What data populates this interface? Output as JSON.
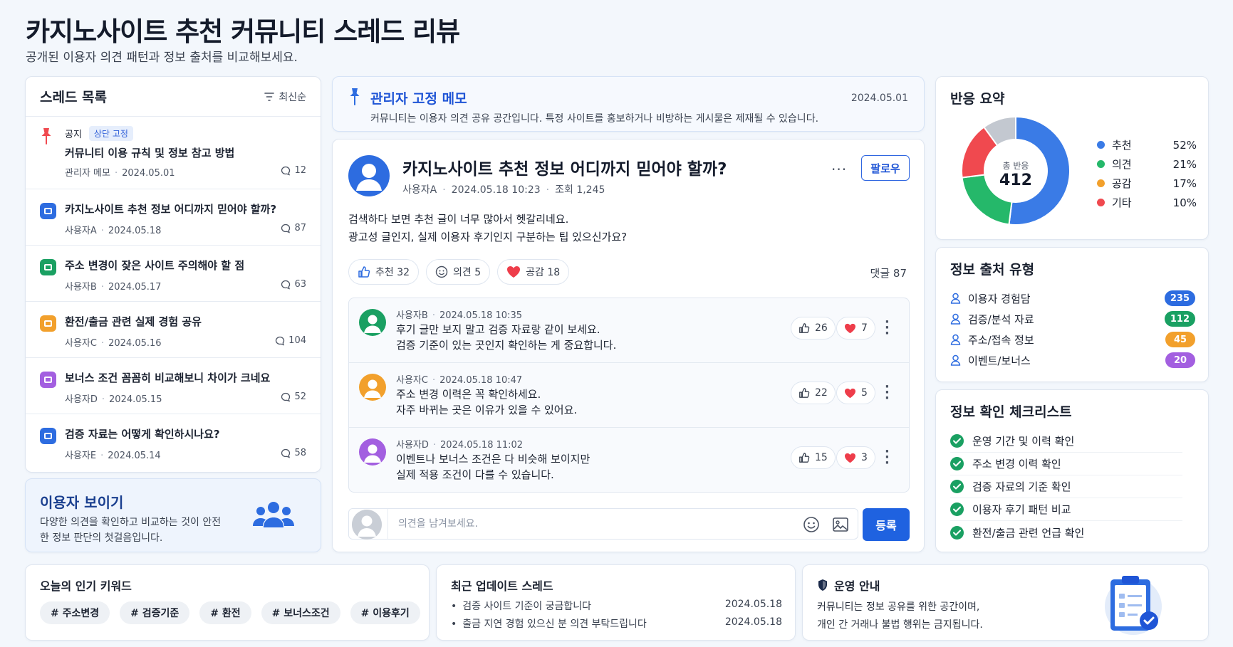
{
  "page": {
    "title": "카지노사이트 추천 커뮤니티 스레드 리뷰",
    "subtitle": "공개된 이용자 의견 패턴과 정보 출처를 비교해보세요."
  },
  "thread_list": {
    "title": "스레드 목록",
    "sort_label": "최신순",
    "pinned": {
      "notice_label": "공지",
      "top_badge": "상단 고정",
      "title": "커뮤니티 이용 규칙 및 정보 참고 방법",
      "author": "관리자 메모",
      "date": "2024.05.01",
      "comments": "12"
    },
    "items": [
      {
        "title": "카지노사이트 추천 정보 어디까지 믿어야 할까?",
        "author": "사용자A",
        "date": "2024.05.18",
        "comments": "87",
        "color": "#2d6ce0"
      },
      {
        "title": "주소 변경이 잦은 사이트 주의해야 할 점",
        "author": "사용자B",
        "date": "2024.05.17",
        "comments": "63",
        "color": "#1aa062"
      },
      {
        "title": "환전/출금 관련 실제 경험 공유",
        "author": "사용자C",
        "date": "2024.05.16",
        "comments": "104",
        "color": "#f2a02c"
      },
      {
        "title": "보너스 조건 꼼꼼히 비교해보니 차이가 크네요",
        "author": "사용자D",
        "date": "2024.05.15",
        "comments": "52",
        "color": "#a35fe0"
      },
      {
        "title": "검증 자료는 어떻게 확인하시나요?",
        "author": "사용자E",
        "date": "2024.05.14",
        "comments": "58",
        "color": "#2d6ce0"
      }
    ]
  },
  "user_card": {
    "title": "이용자 보이기",
    "desc": "다양한 의견을 확인하고 비교하는 것이 안전한 정보 판단의 첫걸음입니다."
  },
  "admin_memo": {
    "title": "관리자 고정 메모",
    "date": "2024.05.01",
    "text": "커뮤니티는 이용자 의견 공유 공간입니다. 특정 사이트를 홍보하거나 비방하는 게시물은 제재될 수 있습니다."
  },
  "post": {
    "title": "카지노사이트 추천 정보 어디까지 믿어야 할까?",
    "author": "사용자A",
    "datetime": "2024.05.18 10:23",
    "views": "조회 1,245",
    "follow_label": "팔로우",
    "body_line1": "검색하다 보면 추천 글이 너무 많아서 헷갈리네요.",
    "body_line2": "광고성 글인지, 실제 이용자 후기인지 구분하는 팁 있으신가요?",
    "reactions": {
      "recommend": "추천 32",
      "opinion": "의견 5",
      "empathy": "공감 18"
    },
    "comment_total": "댓글 87",
    "comments": [
      {
        "author": "사용자B",
        "datetime": "2024.05.18 10:35",
        "line1": "후기 글만 보지 말고 검증 자료랑 같이 보세요.",
        "line2": "검증 기준이 있는 곳인지 확인하는 게 중요합니다.",
        "likes": "26",
        "hearts": "7",
        "color": "#1aa062"
      },
      {
        "author": "사용자C",
        "datetime": "2024.05.18 10:47",
        "line1": "주소 변경 이력은 꼭 확인하세요.",
        "line2": "자주 바뀌는 곳은 이유가 있을 수 있어요.",
        "likes": "22",
        "hearts": "5",
        "color": "#f2a02c"
      },
      {
        "author": "사용자D",
        "datetime": "2024.05.18 11:02",
        "line1": "이벤트나 보너스 조건은 다 비슷해 보이지만",
        "line2": "실제 적용 조건이 다를 수 있습니다.",
        "likes": "15",
        "hearts": "3",
        "color": "#a35fe0"
      }
    ],
    "comment_placeholder": "의견을 남겨보세요.",
    "submit_label": "등록"
  },
  "reaction_summary": {
    "title": "반응 요약",
    "center_label": "총 반응",
    "center_value": "412",
    "chart_data": {
      "type": "pie",
      "categories": [
        "추천",
        "의견",
        "공감",
        "기타"
      ],
      "values": [
        52,
        21,
        17,
        10
      ],
      "colors": [
        "#3a7be6",
        "#25b86a",
        "#f0494f",
        "#c3c8d0"
      ]
    },
    "legend": [
      {
        "label": "추천",
        "pct": "52%",
        "color": "#3a7be6"
      },
      {
        "label": "의견",
        "pct": "21%",
        "color": "#25b86a"
      },
      {
        "label": "공감",
        "pct": "17%",
        "color": "#f2a02c"
      },
      {
        "label": "기타",
        "pct": "10%",
        "color": "#f0494f"
      }
    ]
  },
  "source_types": {
    "title": "정보 출처 유형",
    "items": [
      {
        "label": "이용자 경험담",
        "count": "235",
        "color": "#2d6ce0"
      },
      {
        "label": "검증/분석 자료",
        "count": "112",
        "color": "#1aa062"
      },
      {
        "label": "주소/접속 정보",
        "count": "45",
        "color": "#f2a02c"
      },
      {
        "label": "이벤트/보너스",
        "count": "20",
        "color": "#a35fe0"
      }
    ]
  },
  "checklist": {
    "title": "정보 확인 체크리스트",
    "items": [
      "운영 기간 및 이력 확인",
      "주소 변경 이력 확인",
      "검증 자료의 기준 확인",
      "이용자 후기 패턴 비교",
      "환전/출금 관련 언급 확인"
    ]
  },
  "keywords": {
    "title": "오늘의 인기 키워드",
    "items": [
      "# 주소변경",
      "# 검증기준",
      "# 환전",
      "# 보너스조건",
      "# 이용후기"
    ]
  },
  "recent_updates": {
    "title": "최근 업데이트 스레드",
    "items": [
      {
        "title": "검증 사이트 기준이 궁금합니다",
        "date": "2024.05.18"
      },
      {
        "title": "출금 지연 경험 있으신 분 의견 부탁드립니다",
        "date": "2024.05.18"
      }
    ]
  },
  "operations": {
    "title": "운영 안내",
    "line1": "커뮤니티는 정보 공유를 위한 공간이며,",
    "line2": "개인 간 거래나 불법 행위는 금지됩니다."
  }
}
